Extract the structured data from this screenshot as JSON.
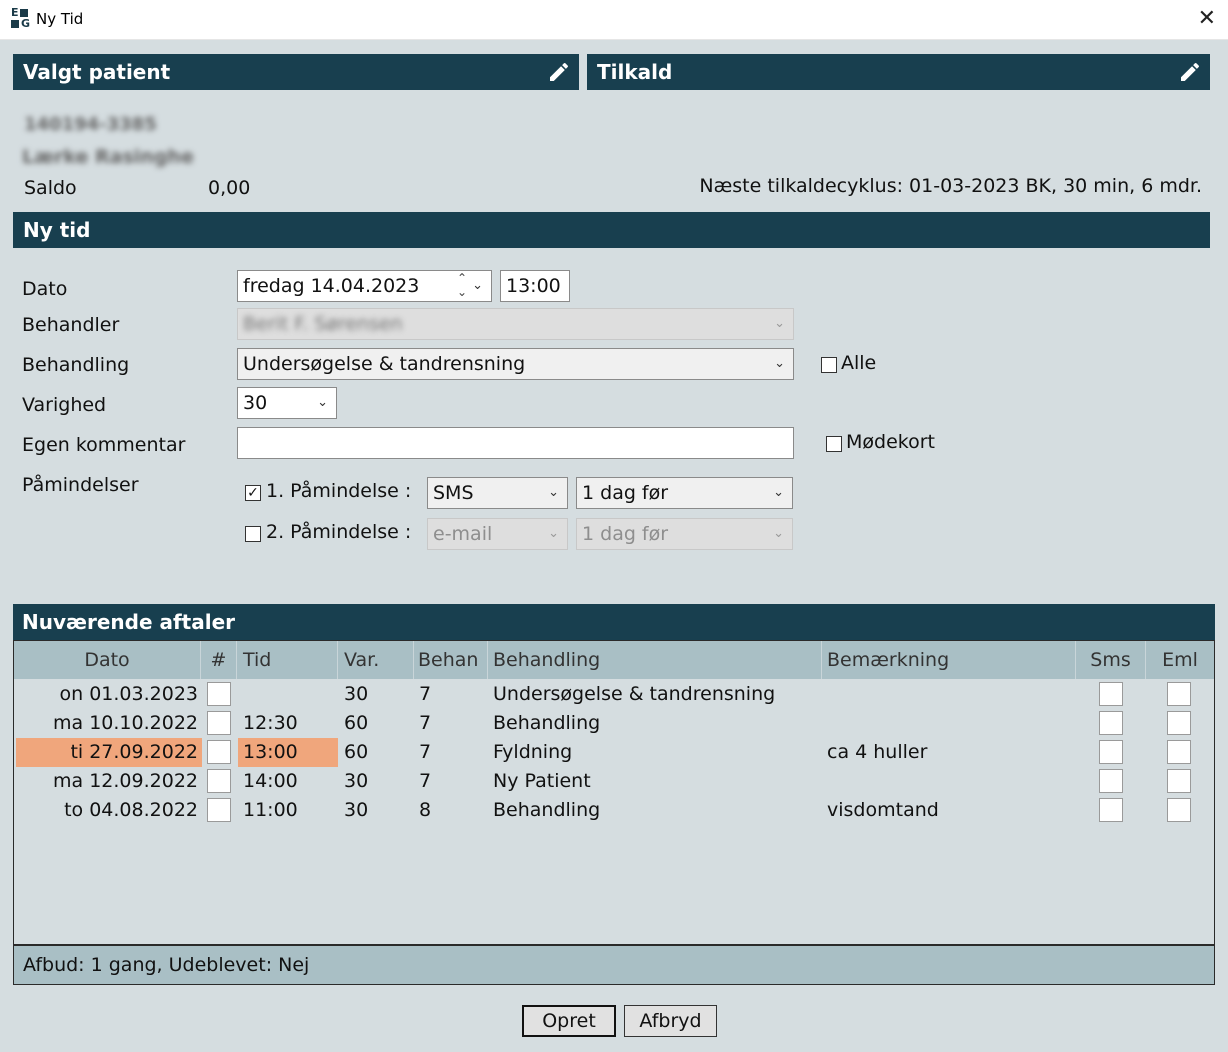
{
  "window": {
    "title": "Ny Tid",
    "icon_letters": [
      "E",
      "G"
    ]
  },
  "patient_panel": {
    "header": "Valgt patient",
    "cpr": "140194-3385",
    "name": "Lærke Rasinghe",
    "saldo_label": "Saldo",
    "saldo_value": "0,00"
  },
  "recall_panel": {
    "header": "Tilkald",
    "next_cycle": "Næste tilkaldecyklus: 01-03-2023 BK, 30 min, 6 mdr."
  },
  "new_appointment": {
    "header": "Ny tid",
    "date_label": "Dato",
    "date_value": "fredag 14.04.2023",
    "time_value": "13:00",
    "practitioner_label": "Behandler",
    "practitioner_value": "Berit F. Sørensen",
    "treatment_label": "Behandling",
    "treatment_value": "Undersøgelse & tandrensning",
    "all_label": "Alle",
    "all_checked": false,
    "duration_label": "Varighed",
    "duration_value": "30",
    "comment_label": "Egen kommentar",
    "comment_value": "",
    "card_label": "Mødekort",
    "card_checked": false,
    "reminders_label": "Påmindelser",
    "reminder1": {
      "label": "1. Påmindelse :",
      "checked": true,
      "channel": "SMS",
      "timing": "1 dag før"
    },
    "reminder2": {
      "label": "2. Påmindelse :",
      "checked": false,
      "channel": "e-mail",
      "timing": "1 dag før"
    }
  },
  "current_appointments": {
    "header": "Nuværende aftaler",
    "columns": [
      "Dato",
      "#",
      "Tid",
      "Var.",
      "Behan",
      "Behandling",
      "Bemærkning",
      "Sms",
      "Eml"
    ],
    "rows": [
      {
        "date": "on 01.03.2023",
        "time": "",
        "var": "30",
        "behan": "7",
        "treatment": "Undersøgelse & tandrensning",
        "note": "",
        "highlighted": false
      },
      {
        "date": "ma 10.10.2022",
        "time": "12:30",
        "var": "60",
        "behan": "7",
        "treatment": "Behandling",
        "note": "",
        "highlighted": false
      },
      {
        "date": "ti 27.09.2022",
        "time": "13:00",
        "var": "60",
        "behan": "7",
        "treatment": "Fyldning",
        "note": "ca 4 huller",
        "highlighted": true
      },
      {
        "date": "ma 12.09.2022",
        "time": "14:00",
        "var": "30",
        "behan": "7",
        "treatment": "Ny Patient",
        "note": "",
        "highlighted": false
      },
      {
        "date": "to 04.08.2022",
        "time": "11:00",
        "var": "30",
        "behan": "8",
        "treatment": "Behandling",
        "note": "visdomtand",
        "highlighted": false
      }
    ],
    "footer": "Afbud: 1 gang,  Udeblevet: Nej"
  },
  "buttons": {
    "create": "Opret",
    "cancel": "Afbryd"
  },
  "colors": {
    "header_bar": "#183f4f",
    "background": "#d5dde0",
    "highlight_row": "#f0a67c",
    "table_header": "#a9bfc5"
  },
  "icons": {
    "edit": "pencil-icon",
    "close": "close-icon",
    "dropdown": "chevron-down-icon"
  }
}
